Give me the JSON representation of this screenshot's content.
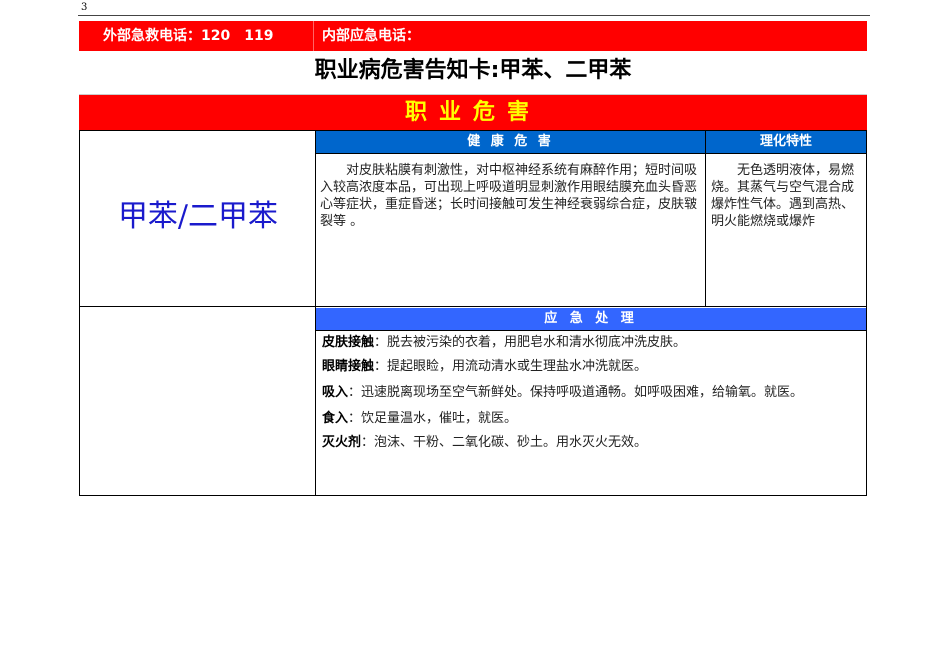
{
  "page_number": "3",
  "phone_bar": {
    "external": "外部急救电话：120　119",
    "internal": "内部应急电话："
  },
  "title": "职业病危害告知卡:甲苯、二甲苯",
  "band": "职业危害",
  "chemical": "甲苯/二甲苯",
  "health": {
    "header": "健 康 危 害",
    "text": "　　对皮肤粘膜有刺激性，对中枢神经系统有麻醉作用；短时间吸入较高浓度本品，可出现上呼吸道明显刺激作用眼结膜充血头昏恶心等症状，重症昏迷；长时间接触可发生神经衰弱综合症，皮肤皲裂等 。"
  },
  "physchem": {
    "header": "理化特性",
    "text": "　　无色透明液体，易燃烧。其蒸气与空气混合成爆炸性气体。遇到高热、明火能燃烧或爆炸"
  },
  "emergency": {
    "header": "应 急 处 理",
    "items": [
      {
        "label": "皮肤接触",
        "text": "：脱去被污染的衣着，用肥皂水和清水彻底冲洗皮肤。"
      },
      {
        "label": "眼睛接触",
        "text": "：提起眼睑，用流动清水或生理盐水冲洗就医。"
      },
      {
        "label": "吸入",
        "text": "：迅速脱离现场至空气新鲜处。保持呼吸道通畅。如呼吸困难，给输氧。就医。"
      },
      {
        "label": "食入",
        "text": "：饮足量温水，催吐，就医。"
      },
      {
        "label": "灭火剂",
        "text": "：泡沫、干粉、二氧化碳、砂土。用水灭火无效。"
      }
    ]
  },
  "colors": {
    "red": "#ff0000",
    "yellow": "#ffff00",
    "blue_header": "#0066cc",
    "blue_header2": "#3366ff",
    "chem_blue": "#1a1acc"
  }
}
